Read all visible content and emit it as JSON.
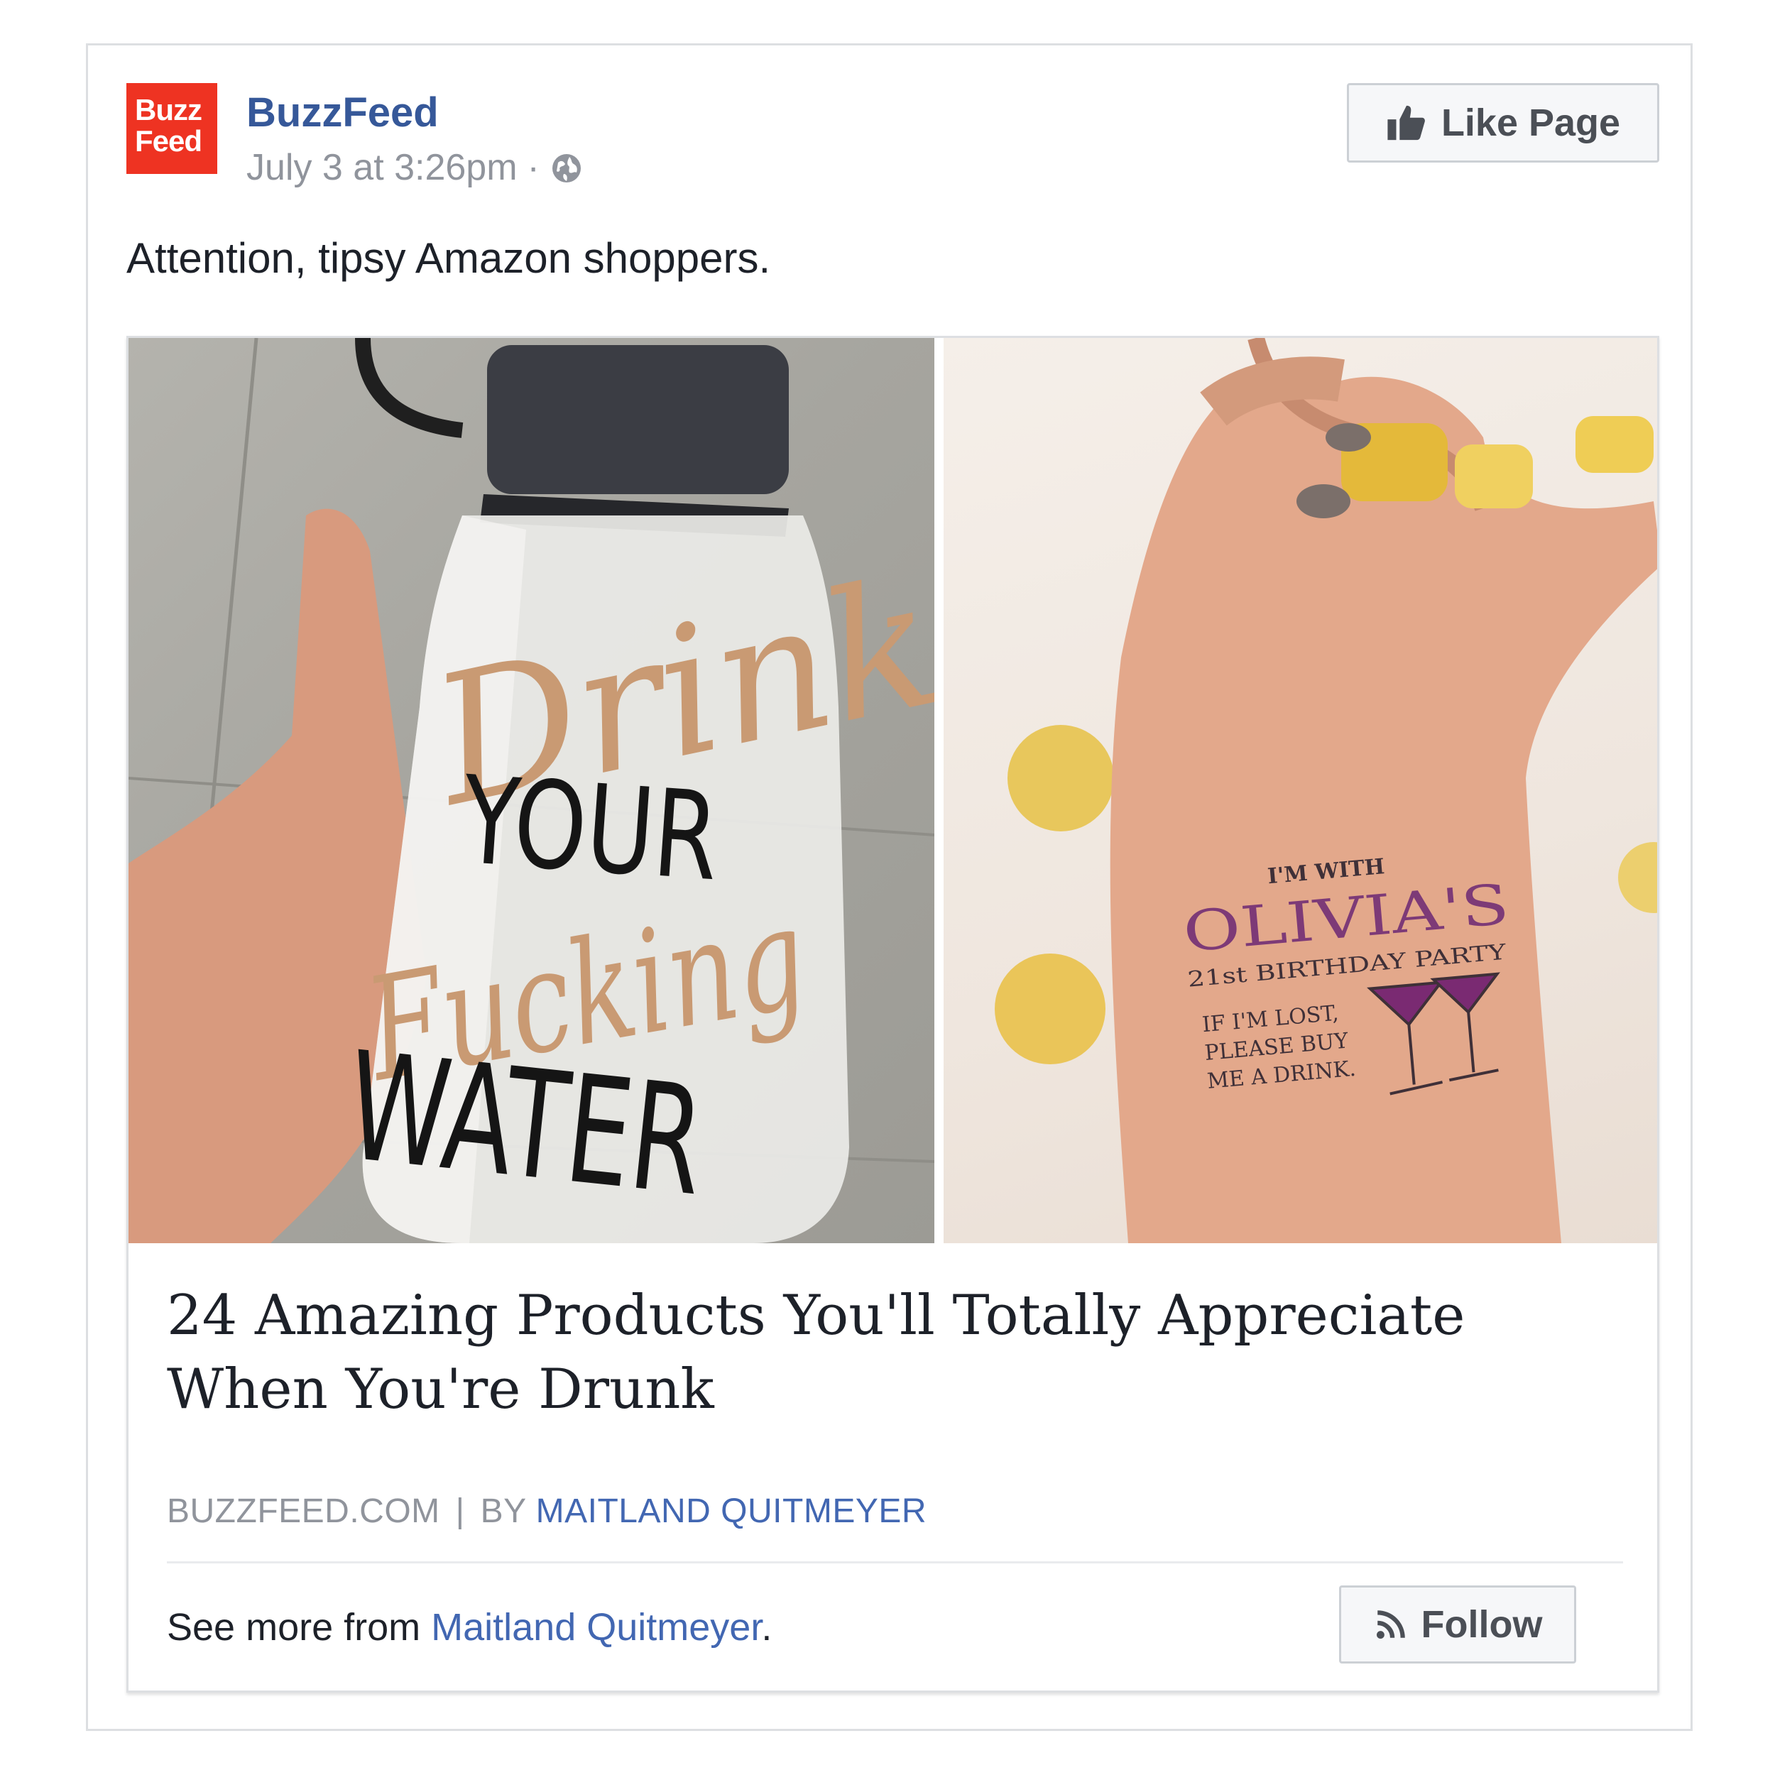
{
  "post": {
    "page_name": "BuzzFeed",
    "avatar": {
      "line1": "Buzz",
      "line2": "Feed",
      "color": "#ee3322"
    },
    "timestamp": "July 3 at 3:26pm",
    "separator": "·",
    "privacy_icon": "globe-icon",
    "like_button": {
      "label": "Like Page",
      "icon": "thumbs-up-icon"
    },
    "message": "Attention, tipsy Amazon shoppers."
  },
  "attachment": {
    "left_image": {
      "script_word_1": "Drink",
      "word_2": "YOUR",
      "script_word_3": "Fucking",
      "word_4": "WATER"
    },
    "right_image": {
      "line1": "I'M WITH",
      "line2": "OLIVIA'S",
      "line3": "21st BIRTHDAY PARTY",
      "line4": "IF I'M LOST,",
      "line5": "PLEASE BUY",
      "line6": "ME A DRINK."
    },
    "headline": "24 Amazing Products You'll Totally Appreciate When You're Drunk",
    "source": "BUZZFEED.COM",
    "pipe": "|",
    "by_label": "BY",
    "author": "MAITLAND QUITMEYER",
    "see_more_prefix": "See more from",
    "see_more_name": "Maitland Quitmeyer",
    "see_more_suffix": ".",
    "follow_button": {
      "label": "Follow",
      "icon": "rss-icon"
    }
  },
  "colors": {
    "link_blue": "#365899",
    "author_blue": "#4267b2",
    "meta_gray": "#90949c",
    "brand_red": "#ee3322"
  }
}
